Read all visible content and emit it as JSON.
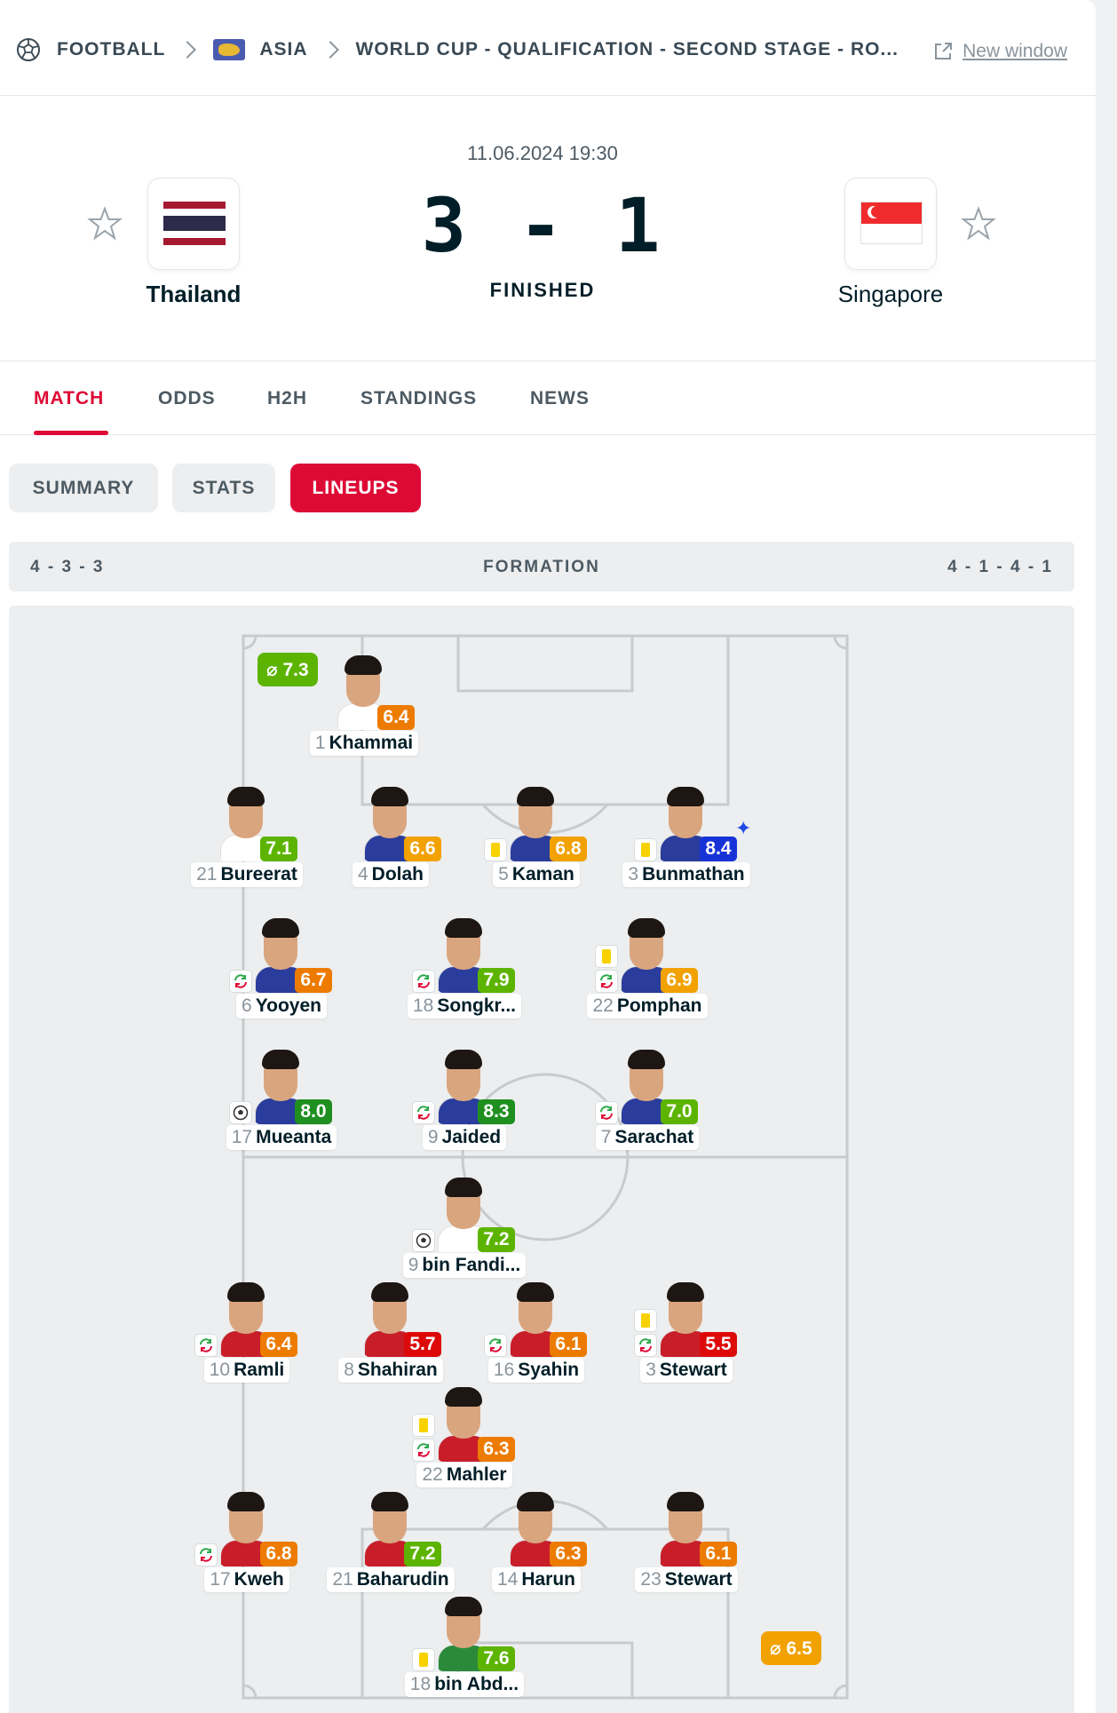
{
  "breadcrumb": {
    "sport": "FOOTBALL",
    "region": "ASIA",
    "competition": "WORLD CUP - QUALIFICATION - SECOND STAGE - RO...",
    "new_window": "New window"
  },
  "match": {
    "datetime": "11.06.2024 19:30",
    "score": "3 - 1",
    "status": "FINISHED",
    "home": {
      "name": "Thailand"
    },
    "away": {
      "name": "Singapore"
    }
  },
  "tabs": [
    "MATCH",
    "ODDS",
    "H2H",
    "STANDINGS",
    "NEWS"
  ],
  "subtabs": [
    "SUMMARY",
    "STATS",
    "LINEUPS"
  ],
  "formation": {
    "home": "4 - 3 - 3",
    "label": "FORMATION",
    "away": "4 - 1 - 4 - 1"
  },
  "averages": {
    "home": "⌀ 7.3",
    "away": "⌀ 6.5"
  },
  "colors": {
    "accent": "#dd0a35",
    "r_green_dark": "#1f8f1f",
    "r_green": "#5cb400",
    "r_orange": "#ec7b00",
    "r_yellow": "#f1a100",
    "r_red": "#dd0a0a",
    "r_blue": "#1733d8"
  },
  "home_players": [
    {
      "num": "1",
      "name": "Khammai",
      "rating": "6.4"
    },
    {
      "num": "21",
      "name": "Bureerat",
      "rating": "7.1"
    },
    {
      "num": "4",
      "name": "Dolah",
      "rating": "6.6"
    },
    {
      "num": "5",
      "name": "Kaman",
      "rating": "6.8"
    },
    {
      "num": "3",
      "name": "Bunmathan",
      "rating": "8.4"
    },
    {
      "num": "6",
      "name": "Yooyen",
      "rating": "6.7"
    },
    {
      "num": "18",
      "name": "Songkr...",
      "rating": "7.9"
    },
    {
      "num": "22",
      "name": "Pomphan",
      "rating": "6.9"
    },
    {
      "num": "17",
      "name": "Mueanta",
      "rating": "8.0"
    },
    {
      "num": "9",
      "name": "Jaided",
      "rating": "8.3"
    },
    {
      "num": "7",
      "name": "Sarachat",
      "rating": "7.0"
    }
  ],
  "away_players": [
    {
      "num": "9",
      "name": "bin Fandi...",
      "rating": "7.2"
    },
    {
      "num": "10",
      "name": "Ramli",
      "rating": "6.4"
    },
    {
      "num": "8",
      "name": "Shahiran",
      "rating": "5.7"
    },
    {
      "num": "16",
      "name": "Syahin",
      "rating": "6.1"
    },
    {
      "num": "3",
      "name": "Stewart",
      "rating": "5.5"
    },
    {
      "num": "22",
      "name": "Mahler",
      "rating": "6.3"
    },
    {
      "num": "17",
      "name": "Kweh",
      "rating": "6.8"
    },
    {
      "num": "21",
      "name": "Baharudin",
      "rating": "7.2"
    },
    {
      "num": "14",
      "name": "Harun",
      "rating": "6.3"
    },
    {
      "num": "23",
      "name": "Stewart",
      "rating": "6.1"
    },
    {
      "num": "18",
      "name": "bin Abd...",
      "rating": "7.6"
    }
  ]
}
